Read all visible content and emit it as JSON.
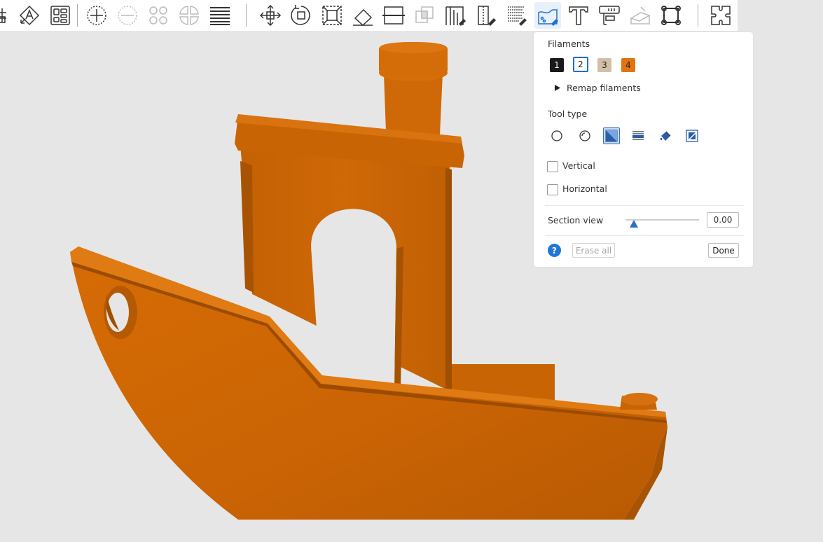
{
  "toolbar": {
    "icons": [
      "grid-icon",
      "auto-orient-icon",
      "arrange-icon",
      "add-instance-icon",
      "remove-instance-icon",
      "split-objects-icon",
      "split-parts-icon",
      "layers-editing-icon",
      "move-icon",
      "rotate-icon",
      "scale-icon",
      "lay-on-face-icon",
      "cut-icon",
      "mesh-boolean-icon",
      "support-painting-icon",
      "seam-painting-icon",
      "fuzzy-skin-icon",
      "color-painting-icon",
      "text-shape-icon",
      "measure-icon",
      "assembly-icon",
      "brim-ears-icon",
      "assembly-view-icon"
    ],
    "active_tool": "color-painting-icon"
  },
  "panel": {
    "filaments_label": "Filaments",
    "filaments": [
      {
        "label": "1",
        "color": "#1a1a1a",
        "text_color": "#ffffff"
      },
      {
        "label": "2",
        "color": "#ffffff",
        "text_color": "#222222"
      },
      {
        "label": "3",
        "color": "#d2bfa8",
        "text_color": "#222222"
      },
      {
        "label": "4",
        "color": "#e2750f",
        "text_color": "#222222"
      }
    ],
    "selected_filament": "2",
    "remap_label": "Remap filaments",
    "tool_type_label": "Tool type",
    "tool_types": [
      "circle-brush-icon",
      "sphere-brush-icon",
      "triangle-fill-icon",
      "height-range-icon",
      "bucket-fill-icon",
      "gap-fill-icon"
    ],
    "active_tool_type": "triangle-fill-icon",
    "vertical_label": "Vertical",
    "horizontal_label": "Horizontal",
    "section_view_label": "Section view",
    "section_view_value": "0.00",
    "section_view_fraction": 0.06,
    "help_label": "?",
    "erase_all_label": "Erase all",
    "done_label": "Done"
  },
  "model": {
    "color": "#d06a0a"
  }
}
